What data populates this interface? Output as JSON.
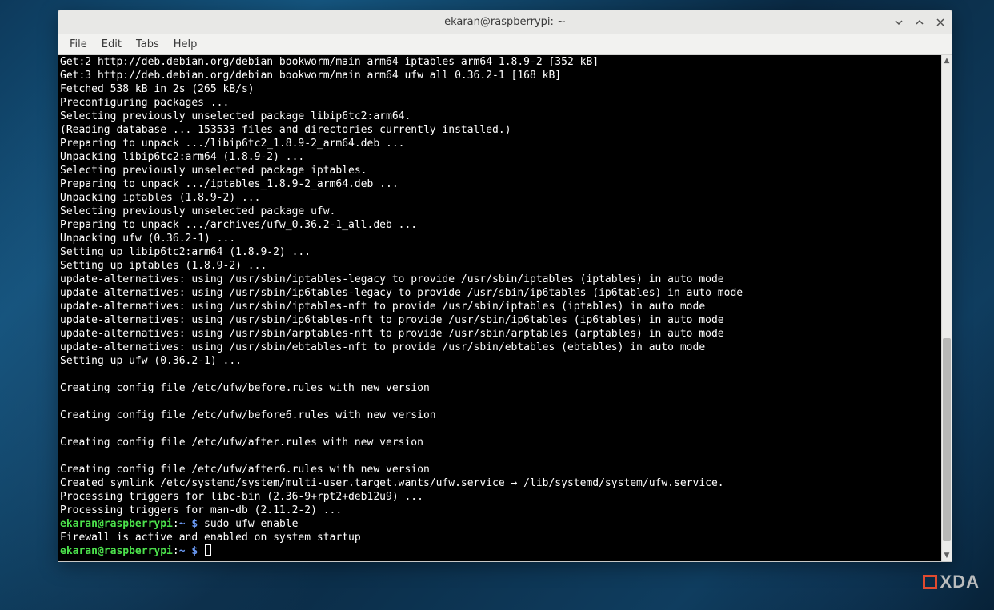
{
  "window": {
    "title": "ekaran@raspberrypi: ~"
  },
  "menubar": {
    "items": [
      "File",
      "Edit",
      "Tabs",
      "Help"
    ]
  },
  "terminal": {
    "lines": [
      "Get:2 http://deb.debian.org/debian bookworm/main arm64 iptables arm64 1.8.9-2 [352 kB]",
      "Get:3 http://deb.debian.org/debian bookworm/main arm64 ufw all 0.36.2-1 [168 kB]",
      "Fetched 538 kB in 2s (265 kB/s)",
      "Preconfiguring packages ...",
      "Selecting previously unselected package libip6tc2:arm64.",
      "(Reading database ... 153533 files and directories currently installed.)",
      "Preparing to unpack .../libip6tc2_1.8.9-2_arm64.deb ...",
      "Unpacking libip6tc2:arm64 (1.8.9-2) ...",
      "Selecting previously unselected package iptables.",
      "Preparing to unpack .../iptables_1.8.9-2_arm64.deb ...",
      "Unpacking iptables (1.8.9-2) ...",
      "Selecting previously unselected package ufw.",
      "Preparing to unpack .../archives/ufw_0.36.2-1_all.deb ...",
      "Unpacking ufw (0.36.2-1) ...",
      "Setting up libip6tc2:arm64 (1.8.9-2) ...",
      "Setting up iptables (1.8.9-2) ...",
      "update-alternatives: using /usr/sbin/iptables-legacy to provide /usr/sbin/iptables (iptables) in auto mode",
      "update-alternatives: using /usr/sbin/ip6tables-legacy to provide /usr/sbin/ip6tables (ip6tables) in auto mode",
      "update-alternatives: using /usr/sbin/iptables-nft to provide /usr/sbin/iptables (iptables) in auto mode",
      "update-alternatives: using /usr/sbin/ip6tables-nft to provide /usr/sbin/ip6tables (ip6tables) in auto mode",
      "update-alternatives: using /usr/sbin/arptables-nft to provide /usr/sbin/arptables (arptables) in auto mode",
      "update-alternatives: using /usr/sbin/ebtables-nft to provide /usr/sbin/ebtables (ebtables) in auto mode",
      "Setting up ufw (0.36.2-1) ...",
      "",
      "Creating config file /etc/ufw/before.rules with new version",
      "",
      "Creating config file /etc/ufw/before6.rules with new version",
      "",
      "Creating config file /etc/ufw/after.rules with new version",
      "",
      "Creating config file /etc/ufw/after6.rules with new version",
      "Created symlink /etc/systemd/system/multi-user.target.wants/ufw.service → /lib/systemd/system/ufw.service.",
      "Processing triggers for libc-bin (2.36-9+rpt2+deb12u9) ...",
      "Processing triggers for man-db (2.11.2-2) ..."
    ],
    "prompt1": {
      "user_host": "ekaran@raspberrypi",
      "path": "~",
      "dollar": "$",
      "command": " sudo ufw enable"
    },
    "response1": "Firewall is active and enabled on system startup",
    "prompt2": {
      "user_host": "ekaran@raspberrypi",
      "path": "~",
      "dollar": "$"
    }
  },
  "scrollbar": {
    "thumb_top_pct": 56,
    "thumb_height_pct": 40
  },
  "watermark": {
    "text": "XDA"
  }
}
